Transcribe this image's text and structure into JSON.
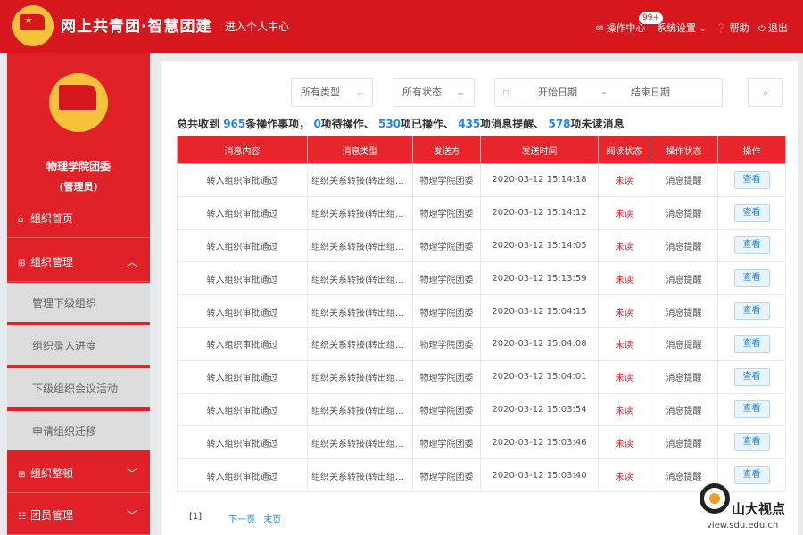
{
  "header": {
    "brand": "网上共青团·智慧团建",
    "personal_center": "进入个人中心",
    "operation_center": "操作中心",
    "badge": "99+",
    "system_settings": "系统设置",
    "help": "帮助",
    "logout": "退出"
  },
  "sidebar": {
    "org_name": "物理学院团委",
    "org_role": "(管理员)",
    "nav": {
      "home": "组织首页",
      "org_manage": "组织管理",
      "org_rectify": "组织整顿",
      "member_manage": "团员管理"
    },
    "sub_items": [
      "管理下级组织",
      "组织录入进度",
      "下级组织会议活动",
      "申请组织迁移"
    ]
  },
  "filters": {
    "type": "所有类型",
    "status": "所有状态",
    "start_date": "开始日期",
    "date_sep": "-",
    "end_date": "结束日期"
  },
  "summary": {
    "p1": "总共收到 ",
    "total": "965",
    "p2": "条操作事项， ",
    "pending": "0",
    "p3": "项待操作、 ",
    "done": "530",
    "p4": "项已操作、 ",
    "reminders": "435",
    "p5": "项消息提醒、 ",
    "unread": "578",
    "p6": "项未读消息"
  },
  "table": {
    "headers": [
      "消息内容",
      "消息类型",
      "发送方",
      "发送时间",
      "阅读状态",
      "操作状态",
      "操作"
    ],
    "rows": [
      {
        "content": "转入组织审批通过",
        "type": "组织关系转接(转出组织...",
        "sender": "物理学院团委",
        "time": "2020-03-12 15:14:18",
        "read": "未读",
        "op_status": "消息提醒",
        "action": "查看"
      },
      {
        "content": "转入组织审批通过",
        "type": "组织关系转接(转出组织...",
        "sender": "物理学院团委",
        "time": "2020-03-12 15:14:12",
        "read": "未读",
        "op_status": "消息提醒",
        "action": "查看"
      },
      {
        "content": "转入组织审批通过",
        "type": "组织关系转接(转出组织...",
        "sender": "物理学院团委",
        "time": "2020-03-12 15:14:05",
        "read": "未读",
        "op_status": "消息提醒",
        "action": "查看"
      },
      {
        "content": "转入组织审批通过",
        "type": "组织关系转接(转出组织...",
        "sender": "物理学院团委",
        "time": "2020-03-12 15:13:59",
        "read": "未读",
        "op_status": "消息提醒",
        "action": "查看"
      },
      {
        "content": "转入组织审批通过",
        "type": "组织关系转接(转出组织...",
        "sender": "物理学院团委",
        "time": "2020-03-12 15:04:15",
        "read": "未读",
        "op_status": "消息提醒",
        "action": "查看"
      },
      {
        "content": "转入组织审批通过",
        "type": "组织关系转接(转出组织...",
        "sender": "物理学院团委",
        "time": "2020-03-12 15:04:08",
        "read": "未读",
        "op_status": "消息提醒",
        "action": "查看"
      },
      {
        "content": "转入组织审批通过",
        "type": "组织关系转接(转出组织...",
        "sender": "物理学院团委",
        "time": "2020-03-12 15:04:01",
        "read": "未读",
        "op_status": "消息提醒",
        "action": "查看"
      },
      {
        "content": "转入组织审批通过",
        "type": "组织关系转接(转出组织...",
        "sender": "物理学院团委",
        "time": "2020-03-12 15:03:54",
        "read": "未读",
        "op_status": "消息提醒",
        "action": "查看"
      },
      {
        "content": "转入组织审批通过",
        "type": "组织关系转接(转出组织...",
        "sender": "物理学院团委",
        "time": "2020-03-12 15:03:46",
        "read": "未读",
        "op_status": "消息提醒",
        "action": "查看"
      },
      {
        "content": "转入组织审批通过",
        "type": "组织关系转接(转出组织...",
        "sender": "物理学院团委",
        "time": "2020-03-12 15:03:40",
        "read": "未读",
        "op_status": "消息提醒",
        "action": "查看"
      }
    ]
  },
  "pagination": {
    "current": "[1]",
    "next": "下一页",
    "last": "末页"
  },
  "watermark": {
    "name": "山大视点",
    "url": "view.sdu.edu.cn"
  },
  "colors": {
    "brand_red": "#d6171e",
    "sidebar_red": "#e02127",
    "link_blue": "#1e88e5",
    "emblem_gold": "#f6c23b"
  }
}
